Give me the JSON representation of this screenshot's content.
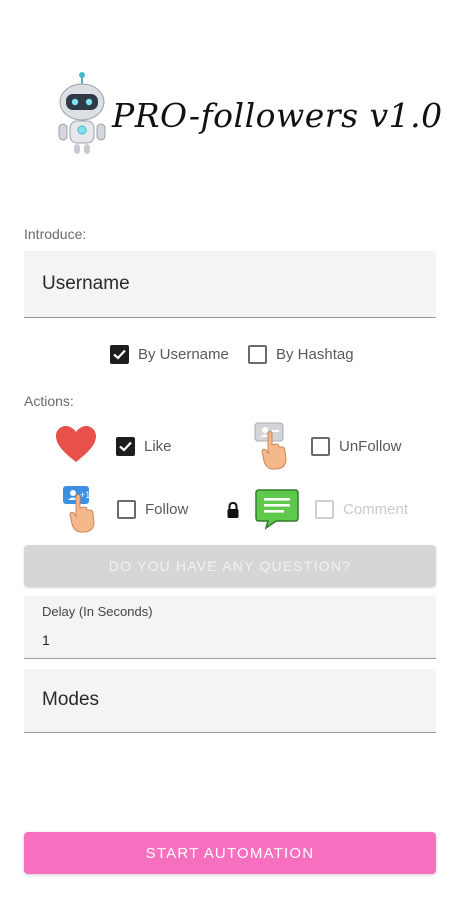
{
  "header": {
    "title": "PRO-followers v1.0"
  },
  "introduce": {
    "label": "Introduce:",
    "username_placeholder": "Username",
    "by_username_label": "By Username",
    "by_username_checked": true,
    "by_hashtag_label": "By Hashtag",
    "by_hashtag_checked": false
  },
  "actions": {
    "label": "Actions:",
    "like_label": "Like",
    "like_checked": true,
    "unfollow_label": "UnFollow",
    "unfollow_checked": false,
    "follow_label": "Follow",
    "follow_checked": false,
    "comment_label": "Comment",
    "comment_checked": false,
    "comment_locked": true
  },
  "question_button": "DO YOU HAVE ANY QUESTION?",
  "delay": {
    "label": "Delay (In Seconds)",
    "value": "1"
  },
  "modes": {
    "placeholder": "Modes"
  },
  "start_button": "START AUTOMATION",
  "colors": {
    "accent": "#f770c0",
    "heart": "#e8504a",
    "comment_bubble": "#5ec94a",
    "hand": "#f5b88a",
    "card_blue": "#3d8fe0"
  },
  "icons": {
    "robot": "robot-mascot-icon",
    "like": "heart-icon",
    "unfollow": "unfollow-hand-icon",
    "follow": "follow-hand-icon",
    "lock": "lock-icon",
    "comment": "comment-bubble-icon"
  }
}
